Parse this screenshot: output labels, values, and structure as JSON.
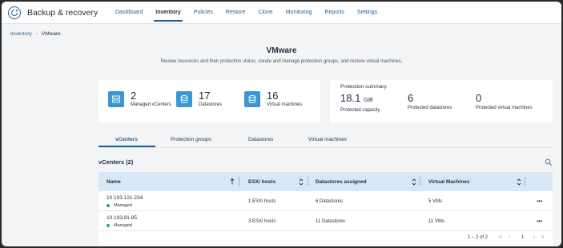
{
  "app": {
    "title": "Backup & recovery",
    "icon": "refresh-shield-icon"
  },
  "nav": [
    {
      "label": "Dashboard",
      "active": false
    },
    {
      "label": "Inventory",
      "active": true
    },
    {
      "label": "Policies",
      "active": false
    },
    {
      "label": "Restore",
      "active": false
    },
    {
      "label": "Clone",
      "active": false
    },
    {
      "label": "Monitoring",
      "active": false
    },
    {
      "label": "Reports",
      "active": false
    },
    {
      "label": "Settings",
      "active": false
    }
  ],
  "breadcrumb": {
    "parent": "Inventory",
    "separator": "›",
    "current": "VMware"
  },
  "page": {
    "title": "VMware",
    "subtitle": "Review resources and their protection status, create and manage protection groups, and restore virtual machines."
  },
  "summary": [
    {
      "value": "2",
      "label": "Managed vCenters",
      "icon": "server-icon"
    },
    {
      "value": "17",
      "label": "Datastores",
      "icon": "database-icon"
    },
    {
      "value": "16",
      "label": "Virtual machines",
      "icon": "database-icon"
    }
  ],
  "protection": {
    "title": "Protection summary",
    "items": [
      {
        "value": "18.1",
        "unit": "GiB",
        "label": "Protected capacity"
      },
      {
        "value": "6",
        "unit": "",
        "label": "Protected datastores"
      },
      {
        "value": "0",
        "unit": "",
        "label": "Protected virtual machines"
      }
    ]
  },
  "tabs": [
    {
      "label": "vCenters",
      "active": true
    },
    {
      "label": "Protection groups",
      "active": false
    },
    {
      "label": "Datastores",
      "active": false
    },
    {
      "label": "Virtual machines",
      "active": false
    }
  ],
  "section": {
    "title": "vCenters (2)"
  },
  "table": {
    "columns": [
      "Name",
      "ESXi hosts",
      "Datastores assigned",
      "Virtual Machines"
    ],
    "rows": [
      {
        "name": "10.193.121.234",
        "status": "Managed",
        "hosts": "1 ESXi hosts",
        "datastores": "6 Datastores",
        "vms": "5 VMs"
      },
      {
        "name": "10.193.91.85",
        "status": "Managed",
        "hosts": "3 ESXi hosts",
        "datastores": "11 Datastores",
        "vms": "11 VMs"
      }
    ],
    "more_label": "•••"
  },
  "pagination": {
    "range": "1 – 2 of 2",
    "page": "1",
    "first": "«",
    "prev": "‹",
    "next": "›",
    "last": "»"
  },
  "colors": {
    "accent": "#1b5e96",
    "icon_bg": "#3b97d3",
    "status_green": "#1aa67b",
    "header_bg": "#d7e7f6"
  }
}
